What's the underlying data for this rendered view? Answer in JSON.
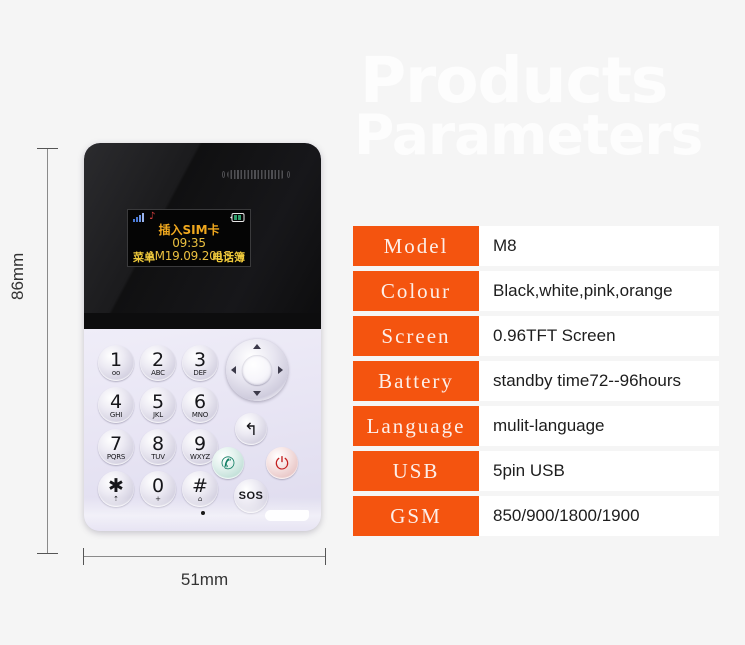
{
  "background_color": "#f5f5f5",
  "heading": {
    "line1": "Products",
    "line2": "Parameters",
    "color": "#fdfdfd"
  },
  "accent_color": "#f4540f",
  "spec_table": {
    "rows": [
      {
        "label": "Model",
        "value": "M8"
      },
      {
        "label": "Colour",
        "value": "Black,white,pink,orange"
      },
      {
        "label": "Screen",
        "value": "0.96TFT Screen"
      },
      {
        "label": "Battery",
        "value": "standby time72--96hours"
      },
      {
        "label": "Language",
        "value": "mulit-language"
      },
      {
        "label": "USB",
        "value": "5pin USB"
      },
      {
        "label": "GSM",
        "value": "850/900/1800/1900"
      }
    ]
  },
  "dimensions": {
    "height_label": "86mm",
    "width_label": "51mm"
  },
  "phone": {
    "screen": {
      "notice": "插入SIM卡",
      "time": "09:35 AM19.09.2015",
      "softkey_left": "菜单",
      "softkey_right": "电话簿",
      "notice_color": "#f0a81e",
      "time_color": "#ebc040",
      "softkey_color": "#edc83a"
    },
    "keypad": [
      {
        "digit": "1",
        "sub": "oo"
      },
      {
        "digit": "2",
        "sub": "ABC"
      },
      {
        "digit": "3",
        "sub": "DEF"
      },
      {
        "digit": "4",
        "sub": "GHI"
      },
      {
        "digit": "5",
        "sub": "JKL"
      },
      {
        "digit": "6",
        "sub": "MNO"
      },
      {
        "digit": "7",
        "sub": "PQRS"
      },
      {
        "digit": "8",
        "sub": "TUV"
      },
      {
        "digit": "9",
        "sub": "WXYZ"
      },
      {
        "digit": "✱",
        "sub": "⇡"
      },
      {
        "digit": "0",
        "sub": "+"
      },
      {
        "digit": "#",
        "sub": "⌂"
      }
    ],
    "function_keys": {
      "back": "↰",
      "call": "✆",
      "power": "⏻",
      "sos": "SOS"
    }
  }
}
